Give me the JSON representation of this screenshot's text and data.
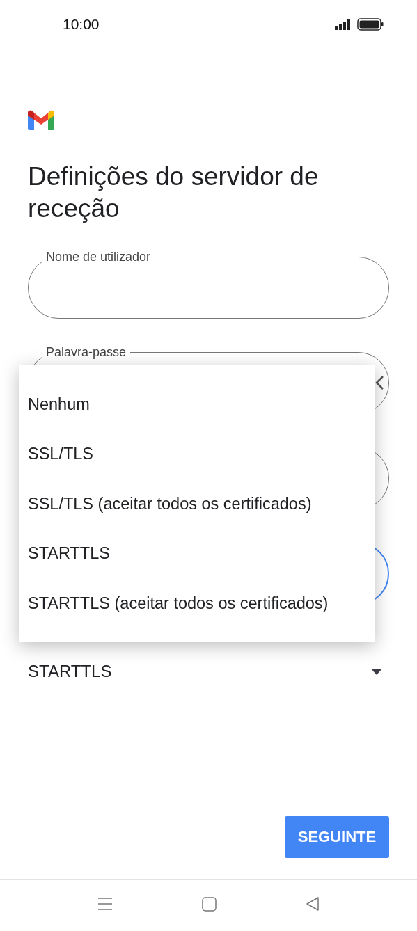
{
  "status_bar": {
    "time": "10:00"
  },
  "title": "Definições do servidor de receção",
  "fields": [
    {
      "label": "Nome de utilizador",
      "focused": false
    },
    {
      "label": "Palavra-passe",
      "focused": false
    },
    {
      "focused": false
    },
    {
      "focused": true
    }
  ],
  "security_type": {
    "value": "STARTTLS"
  },
  "menu": [
    "Nenhum",
    "SSL/TLS",
    "SSL/TLS (aceitar todos os certificados)",
    "STARTTLS",
    "STARTTLS (aceitar todos os certificados)"
  ],
  "button": "SEGUINTE"
}
